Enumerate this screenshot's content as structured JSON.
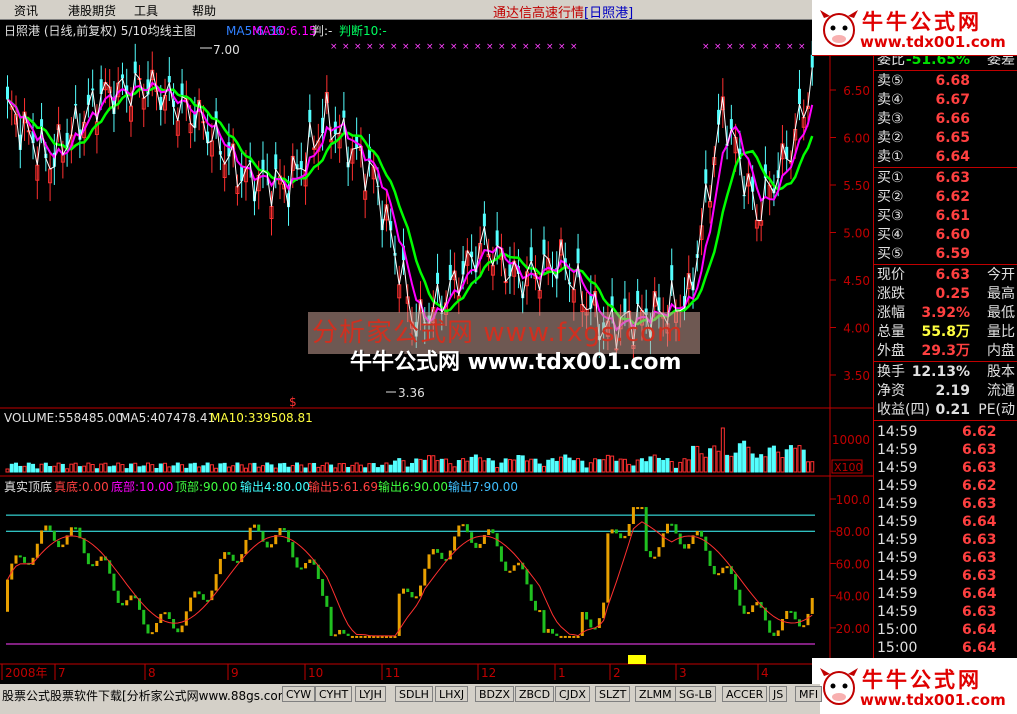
{
  "menu": {
    "items": [
      "资讯",
      "港股期货",
      "工具",
      "帮助"
    ],
    "title": "通达信高速行情",
    "stock_tag": "[日照港]"
  },
  "main_header": {
    "name": "日照港",
    "mode": "(日线,前复权)",
    "indicator": "5/10均线主图",
    "ma5": "MA5:6.36",
    "ma10": "MA10:6.15",
    "judge": "判:-",
    "judge10": "判断10:-",
    "high_mark": "7.00",
    "low_mark": "3.36"
  },
  "price_axis": [
    "6.50",
    "6.00",
    "5.50",
    "5.00",
    "4.50",
    "4.00",
    "3.50"
  ],
  "volume_header": {
    "volume": "VOLUME:558485.00",
    "ma5": "MA5:407478.41",
    "ma10": "MA10:339508.81"
  },
  "volume_axis": [
    "10000",
    "X100"
  ],
  "osc_header": {
    "name": "真实顶底",
    "bottom": "真底:0.00",
    "base": "底部:10.00",
    "top": "顶部:90.00",
    "out4": "输出4:80.00",
    "out5": "输出5:61.69",
    "out6": "输出6:90.00",
    "out7": "输出7:90.00"
  },
  "osc_axis": [
    "100.0",
    "80.00",
    "60.00",
    "40.00",
    "20.00"
  ],
  "date_axis": [
    "2008年",
    "7",
    "8",
    "9",
    "10",
    "11",
    "12",
    "1",
    "2",
    "3",
    "4"
  ],
  "quote": {
    "ratio_label": "委比",
    "ratio_value": "-51.65%",
    "ratio_ext": "委差",
    "sells": [
      {
        "label": "卖⑤",
        "price": "6.68"
      },
      {
        "label": "卖④",
        "price": "6.67"
      },
      {
        "label": "卖③",
        "price": "6.66"
      },
      {
        "label": "卖②",
        "price": "6.65"
      },
      {
        "label": "卖①",
        "price": "6.64"
      }
    ],
    "buys": [
      {
        "label": "买①",
        "price": "6.63"
      },
      {
        "label": "买②",
        "price": "6.62"
      },
      {
        "label": "买③",
        "price": "6.61"
      },
      {
        "label": "买④",
        "price": "6.60"
      },
      {
        "label": "买⑤",
        "price": "6.59"
      }
    ],
    "stats": [
      {
        "label": "现价",
        "value": "6.63",
        "ext": "今开"
      },
      {
        "label": "涨跌",
        "value": "0.25",
        "ext": "最高"
      },
      {
        "label": "涨幅",
        "value": "3.92%",
        "ext": "最低"
      },
      {
        "label": "总量",
        "value": "55.8万",
        "ext": "量比"
      },
      {
        "label": "外盘",
        "value": "29.3万",
        "ext": "内盘"
      }
    ],
    "stats2": [
      {
        "label": "换手",
        "value": "12.13%",
        "ext": "股本"
      },
      {
        "label": "净资",
        "value": "2.19",
        "ext": "流通"
      },
      {
        "label": "收益(四)",
        "value": "0.21",
        "ext": "PE(动"
      }
    ],
    "ticks": [
      {
        "time": "14:59",
        "price": "6.62"
      },
      {
        "time": "14:59",
        "price": "6.63"
      },
      {
        "time": "14:59",
        "price": "6.63"
      },
      {
        "time": "14:59",
        "price": "6.62"
      },
      {
        "time": "14:59",
        "price": "6.63"
      },
      {
        "time": "14:59",
        "price": "6.64"
      },
      {
        "time": "14:59",
        "price": "6.63"
      },
      {
        "time": "14:59",
        "price": "6.63"
      },
      {
        "time": "14:59",
        "price": "6.63"
      },
      {
        "time": "14:59",
        "price": "6.64"
      },
      {
        "time": "14:59",
        "price": "6.63"
      },
      {
        "time": "15:00",
        "price": "6.64"
      },
      {
        "time": "15:00",
        "price": "6.64"
      }
    ]
  },
  "logo": {
    "text": "牛牛公式网",
    "url": "www.tdx001.com"
  },
  "watermark": {
    "line1": "分析家公式网 www.fxgs.com",
    "line2": "牛牛公式网 www.tdx001.com"
  },
  "status": {
    "text": "股票公式股票软件下载[分析家公式网www.88gs.com]"
  },
  "tabs": [
    "CYW",
    "CYHT",
    "LYJH",
    "SDLH",
    "LHXJ",
    "BDZX",
    "ZBCD",
    "CJDX",
    "SLZT",
    "ZLMM",
    "SG-LB",
    "ACCER",
    "JS",
    "MFI"
  ],
  "colors": {
    "up": "#ff3030",
    "down": "#54ffff",
    "ma5": "#ff00ff",
    "ma10": "#00ff00",
    "osc_up": "#e8a000",
    "osc_down": "#20c020",
    "axis_red": "#c00000"
  }
}
